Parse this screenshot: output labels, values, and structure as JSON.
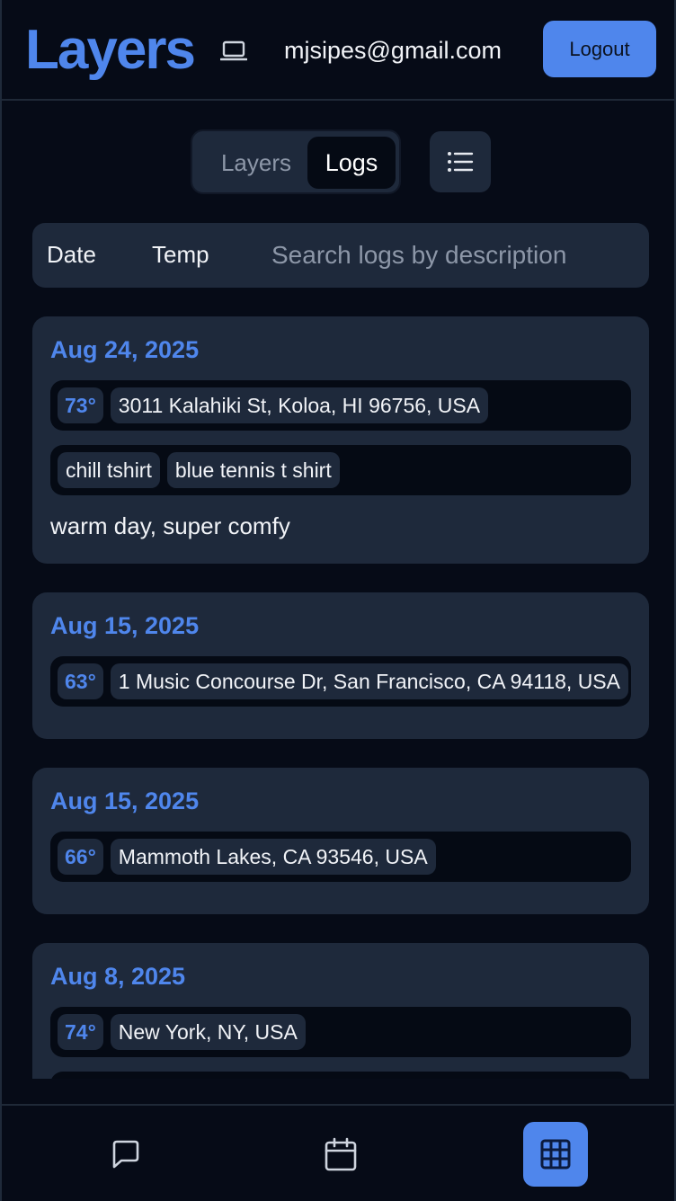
{
  "header": {
    "app_name": "Layers",
    "device_icon": "laptop-icon",
    "user_email": "mjsipes@gmail.com",
    "logout_label": "Logout"
  },
  "view_toggle": {
    "options": [
      "Layers",
      "Logs"
    ],
    "selected": "Logs",
    "list_icon": "list-icon"
  },
  "filters": {
    "sort_date_label": "Date",
    "sort_temp_label": "Temp",
    "search_placeholder": "Search logs by description"
  },
  "logs": [
    {
      "date": "Aug 24, 2025",
      "temp": "73°",
      "location": "3011 Kalahiki St, Koloa, HI 96756, USA",
      "layers": [
        "chill tshirt",
        "blue tennis t shirt"
      ],
      "note": "warm day, super comfy"
    },
    {
      "date": "Aug 15, 2025",
      "temp": "63°",
      "location": "1 Music Concourse Dr, San Francisco, CA 94118, USA"
    },
    {
      "date": "Aug 15, 2025",
      "temp": "66°",
      "location": "Mammoth Lakes, CA 93546, USA"
    },
    {
      "date": "Aug 8, 2025",
      "temp": "74°",
      "location": "New York, NY, USA"
    }
  ],
  "bottom_nav": {
    "items": [
      "chat-icon",
      "calendar-icon",
      "grid-icon"
    ],
    "active": "grid-icon",
    "colors": {
      "accent": "#4f86ec",
      "background": "#060b17",
      "card": "#1e293b"
    }
  }
}
